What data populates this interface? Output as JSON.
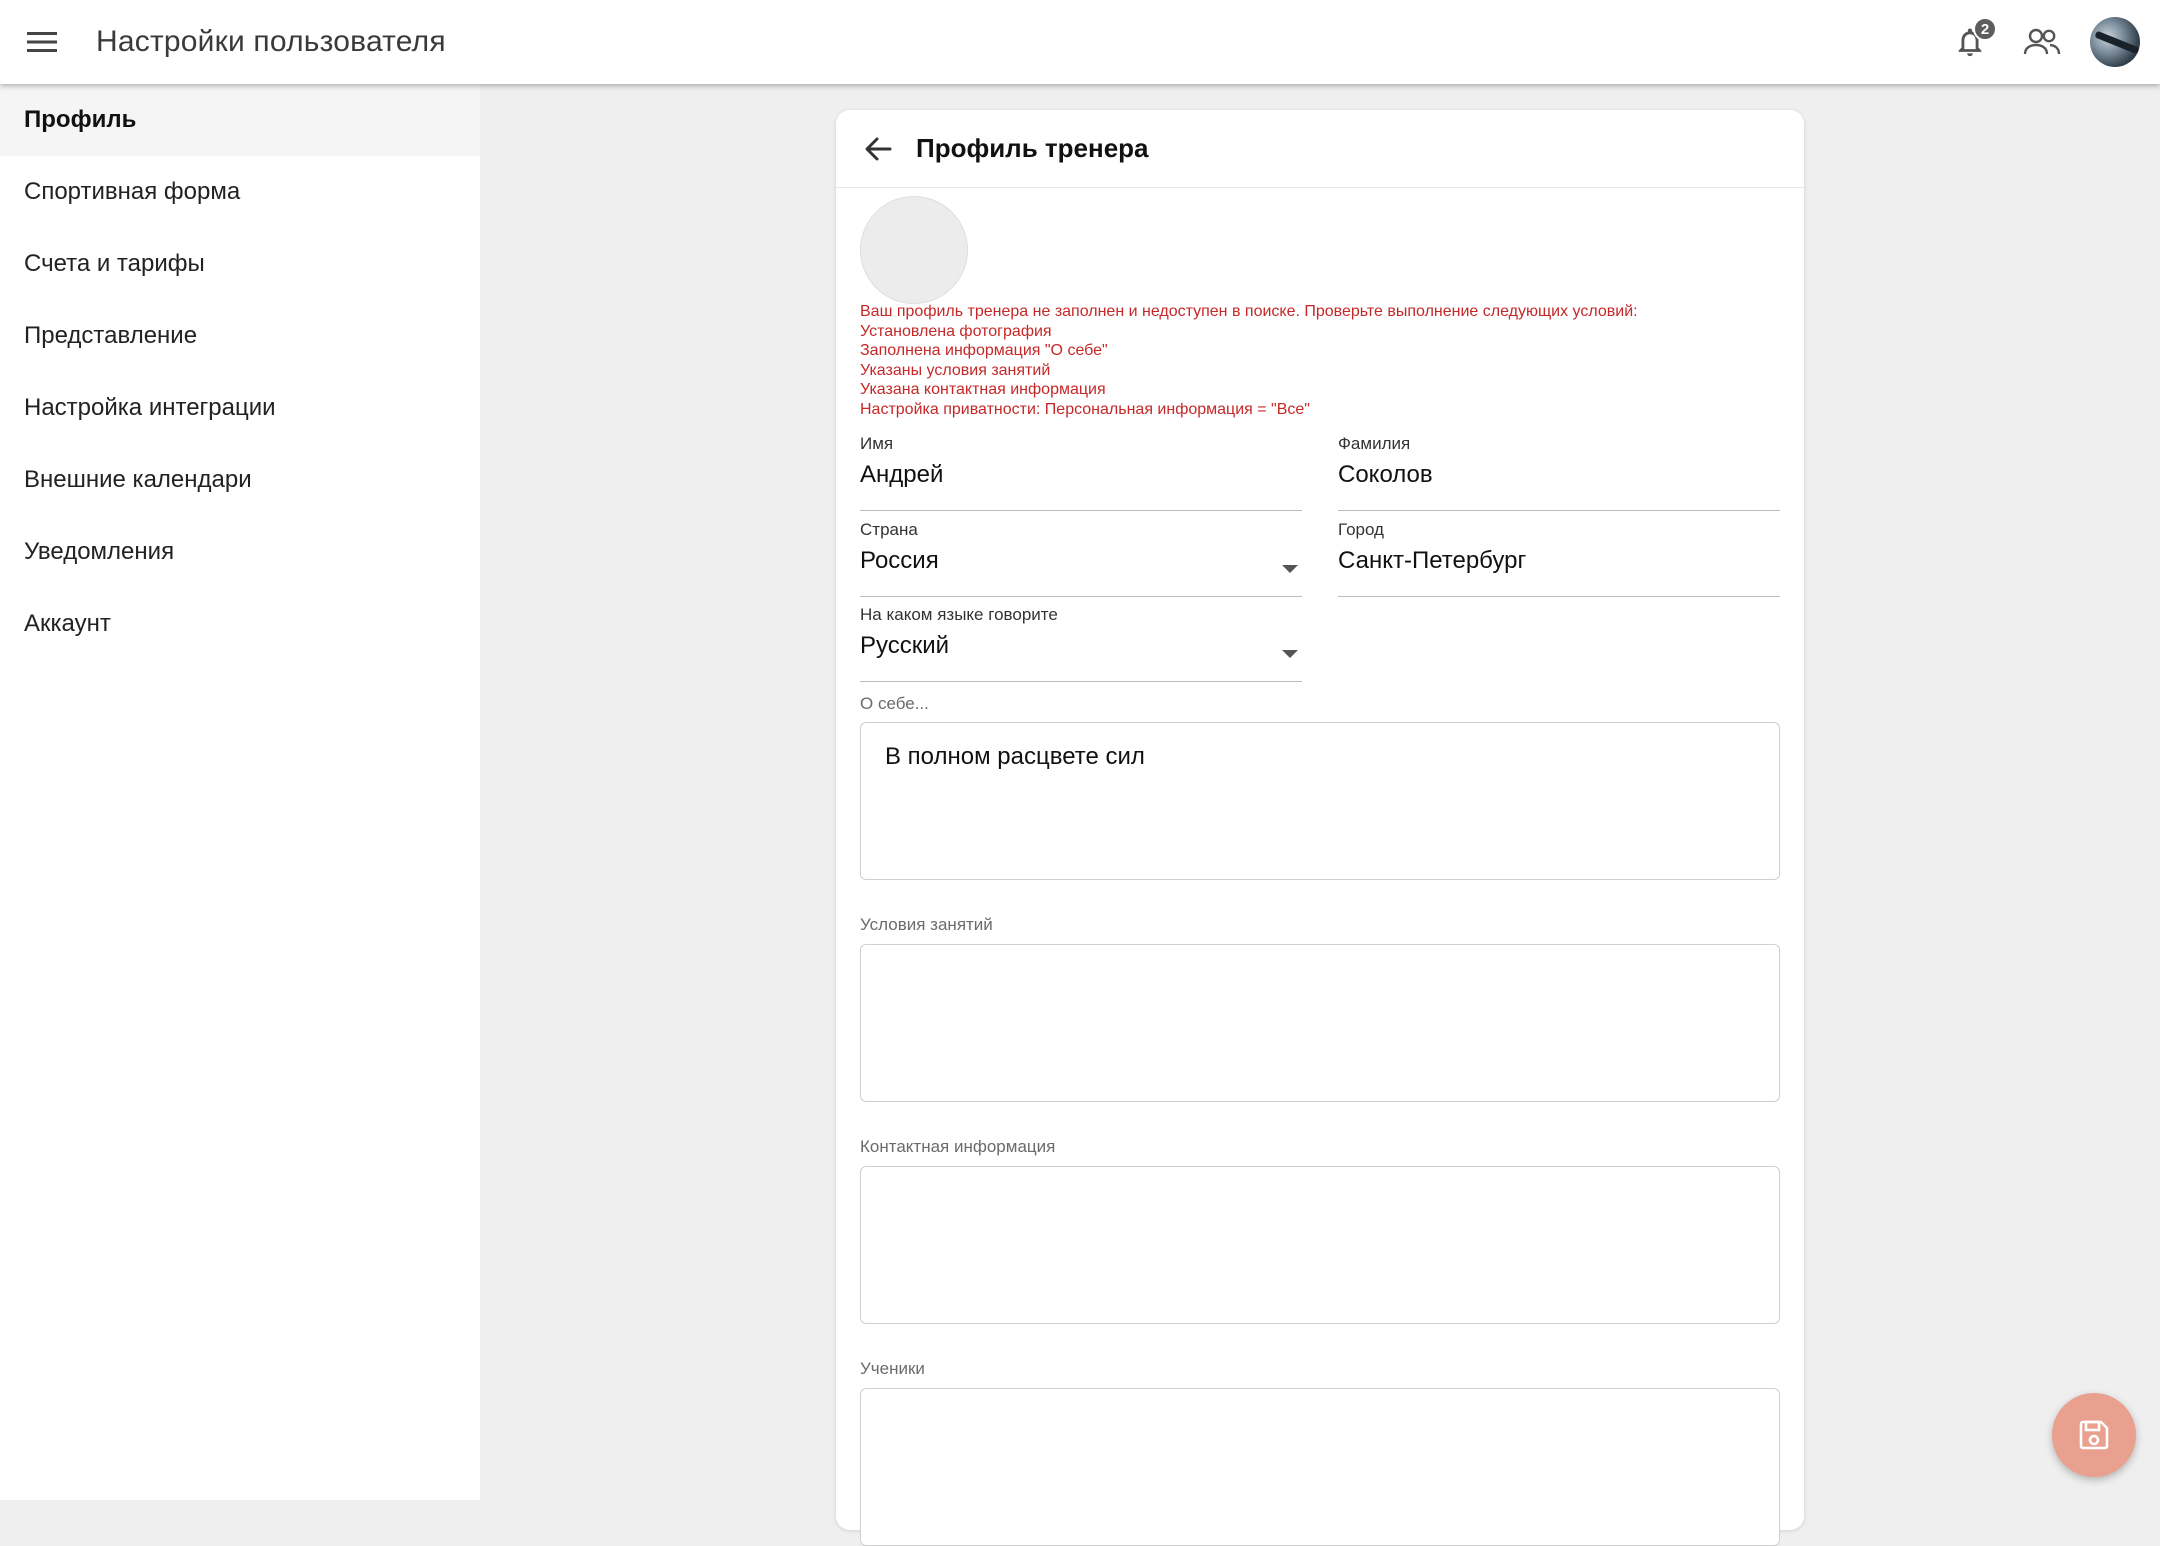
{
  "header": {
    "title": "Настройки пользователя",
    "notifications_count": "2"
  },
  "sidebar": {
    "items": [
      {
        "label": "Профиль",
        "active": true
      },
      {
        "label": "Спортивная форма"
      },
      {
        "label": "Счета и тарифы"
      },
      {
        "label": "Представление"
      },
      {
        "label": "Настройка интеграции"
      },
      {
        "label": "Внешние календари"
      },
      {
        "label": "Уведомления"
      },
      {
        "label": "Аккаунт"
      }
    ]
  },
  "card": {
    "title": "Профиль тренера",
    "warning": {
      "intro": "Ваш профиль тренера не заполнен и недоступен в поиске. Проверьте выполнение следующих условий:",
      "items": [
        "Установлена фотография",
        "Заполнена информация \"О себе\"",
        "Указаны условия занятий",
        "Указана контактная информация",
        "Настройка приватности: Персональная информация = \"Все\""
      ]
    },
    "fields": {
      "first_name": {
        "label": "Имя",
        "value": "Андрей"
      },
      "last_name": {
        "label": "Фамилия",
        "value": "Соколов"
      },
      "country": {
        "label": "Страна",
        "value": "Россия"
      },
      "city": {
        "label": "Город",
        "value": "Санкт-Петербург"
      },
      "language": {
        "label": "На каком языке говорите",
        "value": "Русский"
      }
    },
    "about": {
      "label": "О себе...",
      "value": "В полном расцвете сил"
    },
    "conditions": {
      "label": "Условия занятий",
      "value": ""
    },
    "contacts": {
      "label": "Контактная информация",
      "value": ""
    },
    "students": {
      "label": "Ученики",
      "value": ""
    }
  },
  "colors": {
    "warning": "#c62828",
    "fab": "#eaa08f",
    "background": "#efefef"
  },
  "icons": {
    "menu": "menu-icon",
    "notifications": "bell-icon",
    "users": "people-icon",
    "back": "arrow-left-icon",
    "save": "floppy-disk-icon"
  }
}
